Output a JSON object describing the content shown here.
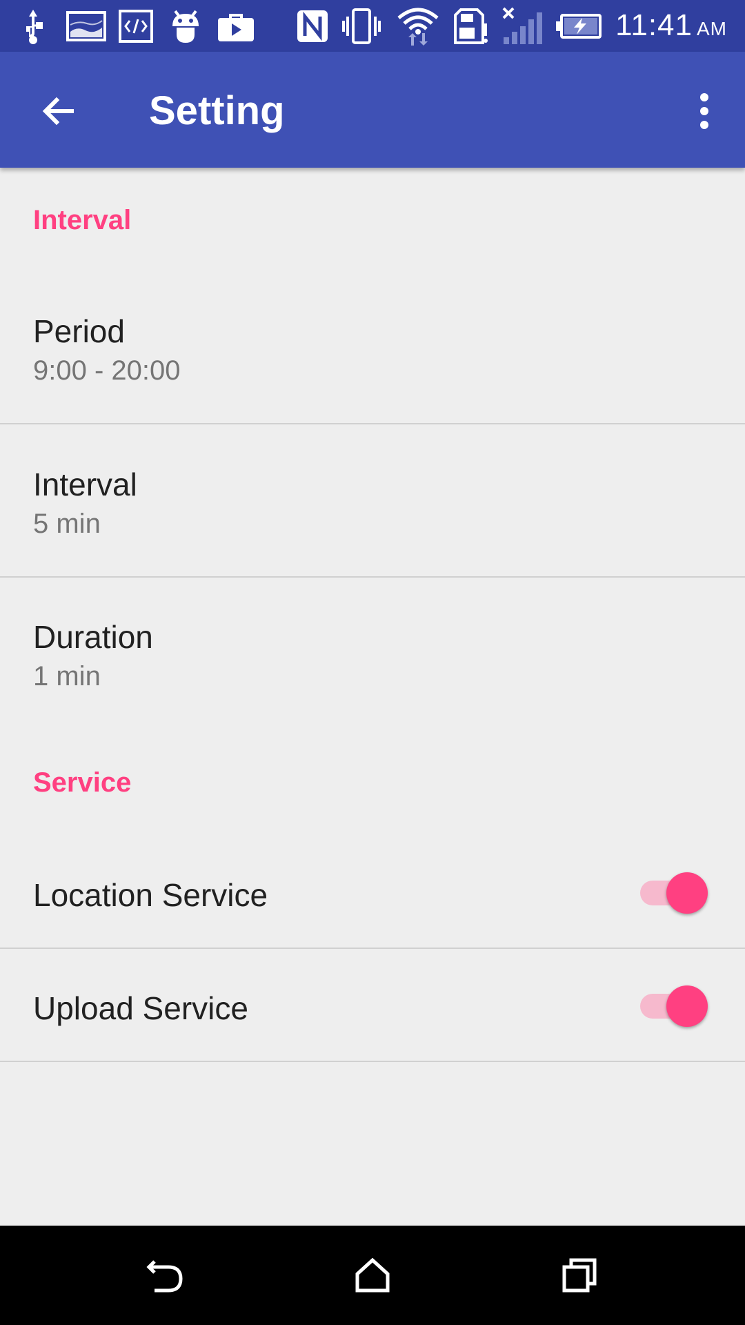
{
  "status_bar": {
    "time": "11:41",
    "ampm": "AM",
    "icons": [
      "usb-icon",
      "image-icon",
      "code-icon",
      "android-icon",
      "video-briefcase-icon",
      "nfc-icon",
      "vibrate-icon",
      "wifi-icon",
      "sd-card-icon",
      "signal-no-service-icon",
      "battery-charging-icon"
    ]
  },
  "app_bar": {
    "title": "Setting",
    "back_icon": "arrow-back-icon",
    "menu_icon": "more-vert-icon"
  },
  "sections": [
    {
      "header": "Interval",
      "items": [
        {
          "title": "Period",
          "summary": "9:00 - 20:00"
        },
        {
          "title": "Interval",
          "summary": "5 min"
        },
        {
          "title": "Duration",
          "summary": "1 min"
        }
      ]
    },
    {
      "header": "Service",
      "items": [
        {
          "title": "Location Service",
          "checked": true
        },
        {
          "title": "Upload Service",
          "checked": true
        }
      ]
    }
  ],
  "nav_bar": {
    "icons": [
      "back-icon",
      "home-icon",
      "recents-icon"
    ]
  },
  "colors": {
    "primary": "#3f51b5",
    "primary_dark": "#303f9f",
    "accent": "#ff4081",
    "background": "#eeeeee"
  }
}
